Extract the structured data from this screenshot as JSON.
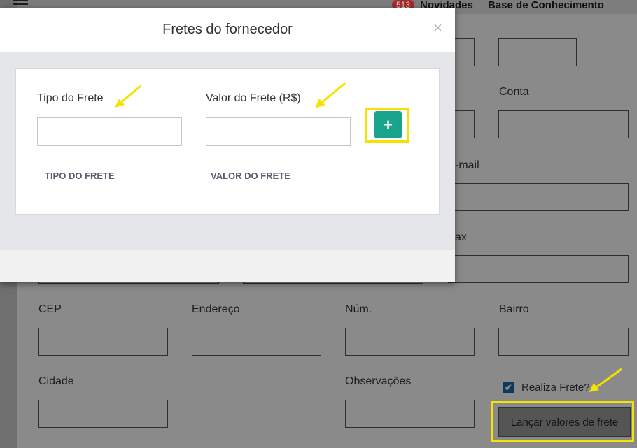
{
  "topbar": {
    "badge_count": "513",
    "novidades_label": "Novidades",
    "base_label": "Base de Conhecimento"
  },
  "form": {
    "conta_label": "Conta",
    "email_label": "-mail",
    "fax_label": "ax",
    "cep_label": "CEP",
    "endereco_label": "Endereço",
    "num_label": "Núm.",
    "bairro_label": "Bairro",
    "cidade_label": "Cidade",
    "observacoes_label": "Observações",
    "realiza_frete_label": "Realiza Frete?",
    "realiza_frete_checked": true,
    "lancar_button_label": "Lançar valores de frete"
  },
  "modal": {
    "title": "Fretes do fornecedor",
    "close_symbol": "×",
    "tipo_label": "Tipo do Frete",
    "tipo_value": "",
    "valor_label": "Valor do Frete (R$)",
    "valor_value": "",
    "add_symbol": "+",
    "table_headers": [
      "TIPO DO FRETE",
      "VALOR DO FRETE"
    ]
  },
  "icons": {
    "menu": "hamburger-icon",
    "close": "close-icon",
    "add": "plus-icon",
    "check": "checkmark-icon",
    "annotation": "arrow-icon"
  },
  "colors": {
    "accent": "#1aa38d",
    "highlight": "#f6e200",
    "badge": "#a52b2b"
  }
}
